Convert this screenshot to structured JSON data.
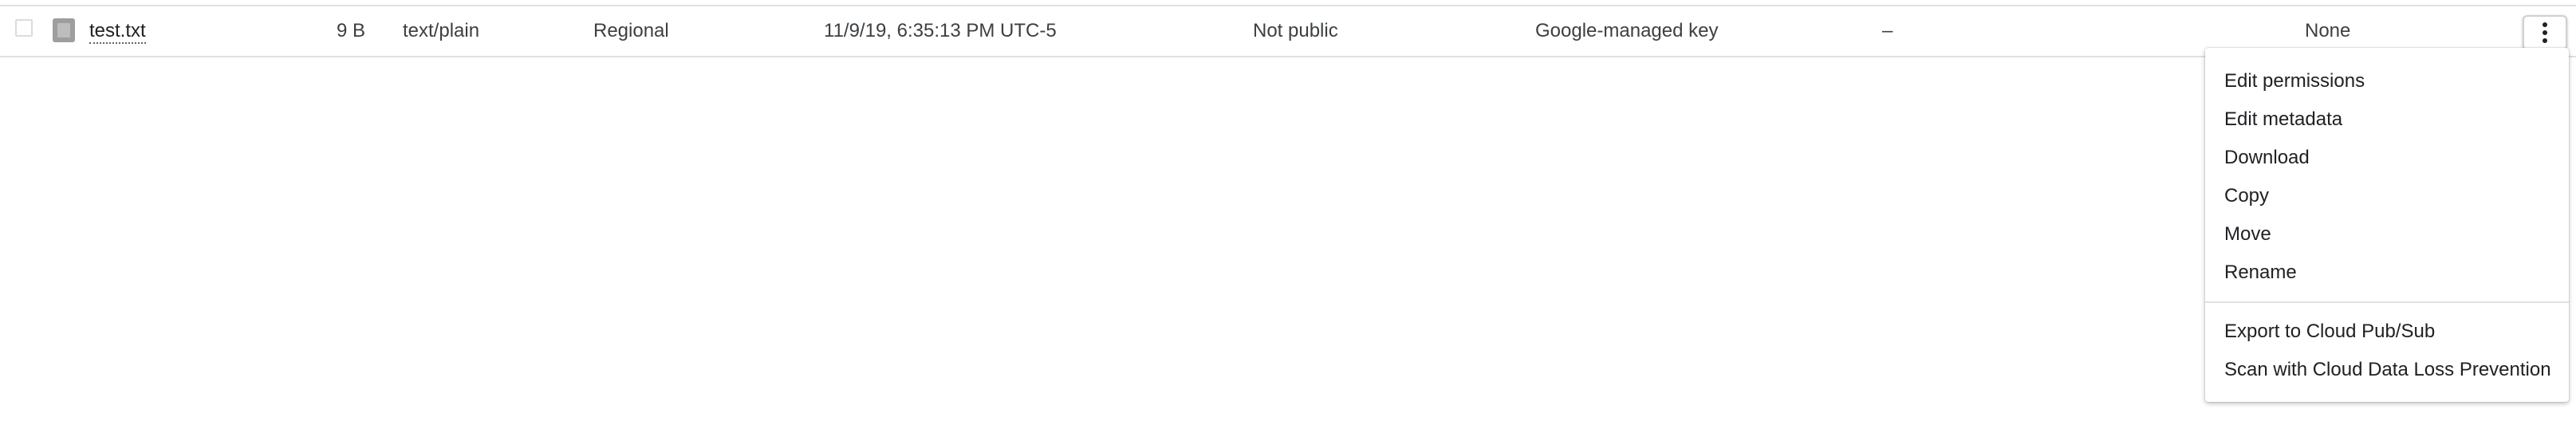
{
  "row": {
    "name": "test.txt",
    "size": "9 B",
    "type": "text/plain",
    "storage_class": "Regional",
    "last_modified": "11/9/19, 6:35:13 PM UTC-5",
    "public_access": "Not public",
    "encryption": "Google-managed key",
    "retention": "–",
    "holds": "None"
  },
  "more_button": {
    "icon": "more-vert-icon"
  },
  "menu": {
    "items": [
      "Edit permissions",
      "Edit metadata",
      "Download",
      "Copy",
      "Move",
      "Rename",
      "Export to Cloud Pub/Sub",
      "Scan with Cloud Data Loss Prevention"
    ]
  }
}
